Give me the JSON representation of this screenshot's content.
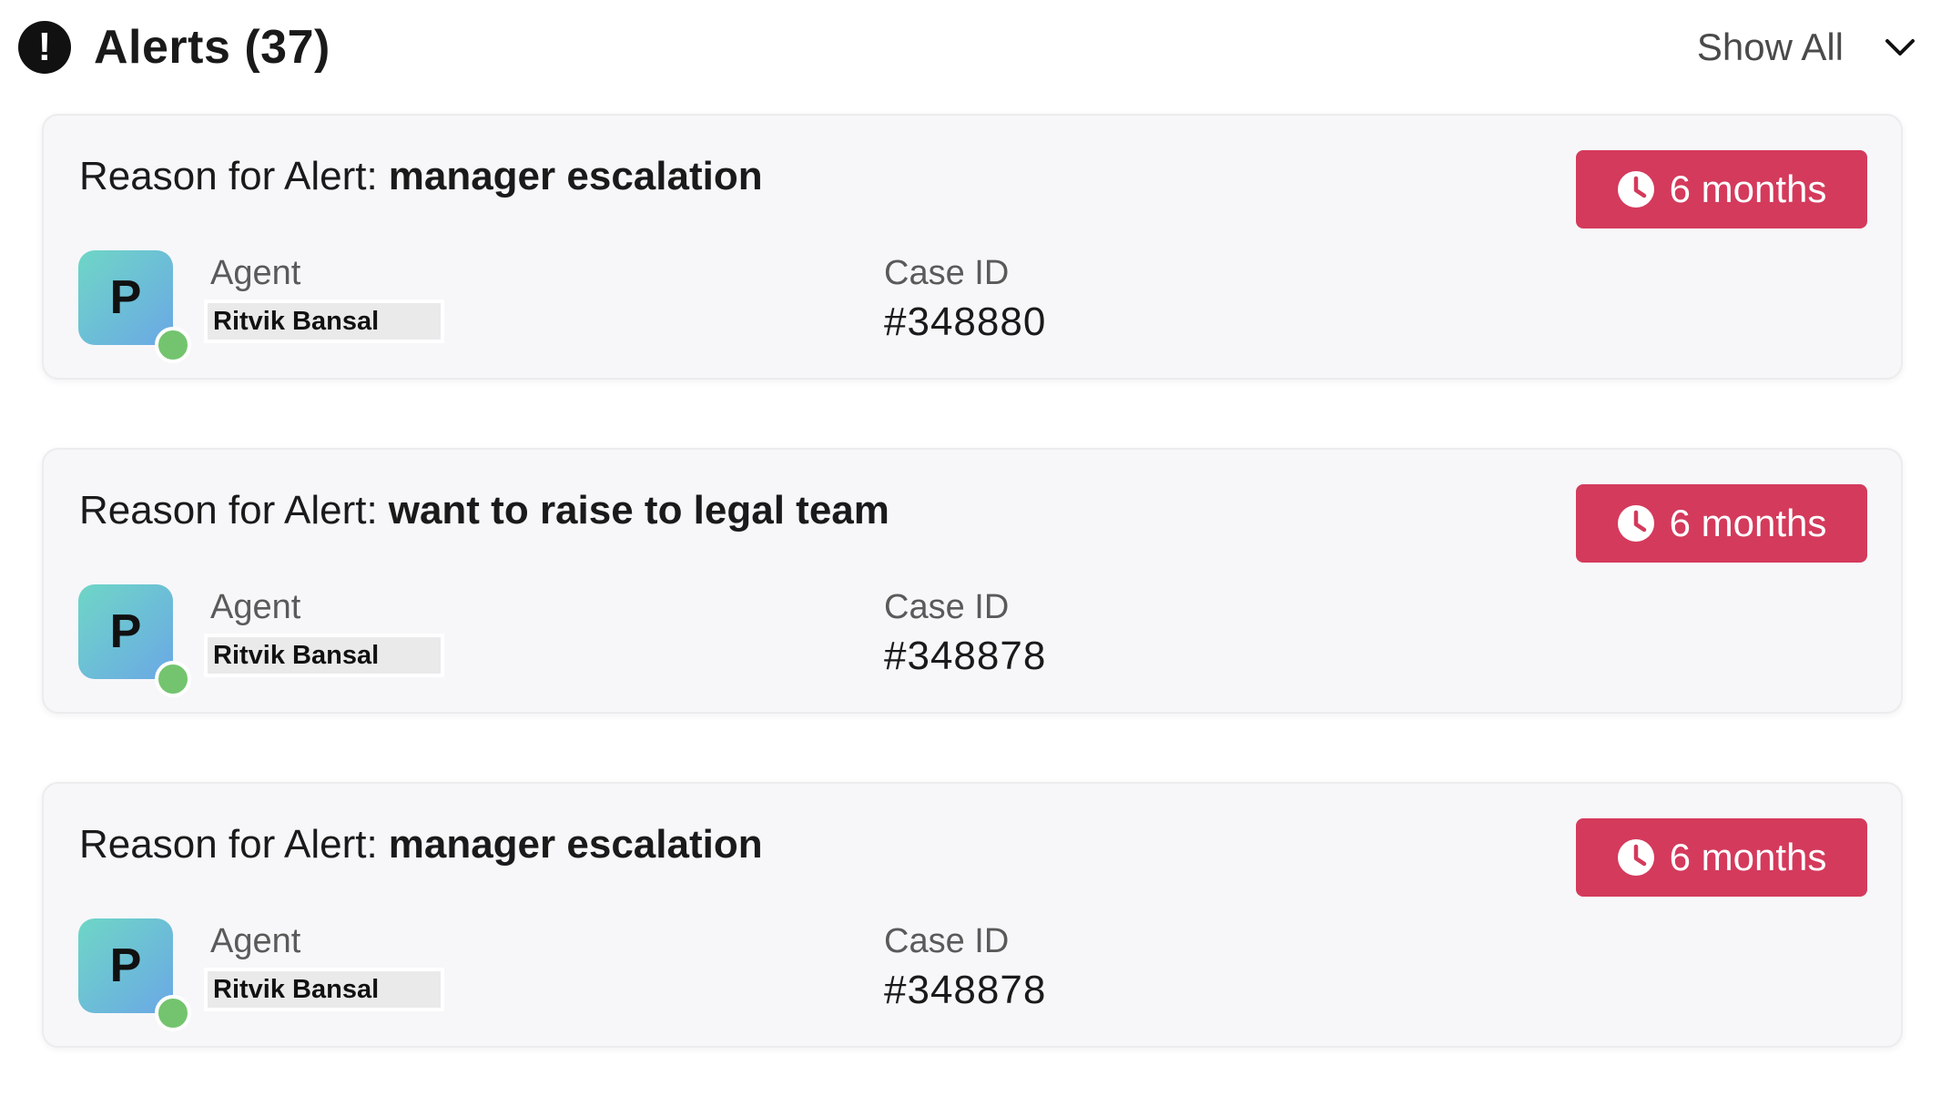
{
  "header": {
    "icon": "exclamation-circle-icon",
    "icon_glyph": "!",
    "title": "Alerts (37)",
    "show_all_label": "Show All",
    "dropdown_icon": "chevron-down-icon"
  },
  "alerts": [
    {
      "reason_label": "Reason for Alert:",
      "reason_value": "manager escalation",
      "time_badge": "6 months",
      "time_icon": "clock-icon",
      "avatar_initial": "P",
      "agent_label": "Agent",
      "agent_name": "Ritvik Bansal",
      "case_label": "Case ID",
      "case_id": "#348880"
    },
    {
      "reason_label": "Reason for Alert:",
      "reason_value": "want to raise to legal team",
      "time_badge": "6 months",
      "time_icon": "clock-icon",
      "avatar_initial": "P",
      "agent_label": "Agent",
      "agent_name": "Ritvik Bansal",
      "case_label": "Case ID",
      "case_id": "#348878"
    },
    {
      "reason_label": "Reason for Alert:",
      "reason_value": "manager escalation",
      "time_badge": "6 months",
      "time_icon": "clock-icon",
      "avatar_initial": "P",
      "agent_label": "Agent",
      "agent_name": "Ritvik Bansal",
      "case_label": "Case ID",
      "case_id": "#348878"
    }
  ],
  "colors": {
    "badge": "#d43a5c",
    "status_online": "#74c46f",
    "card_background": "#f7f7f9"
  }
}
